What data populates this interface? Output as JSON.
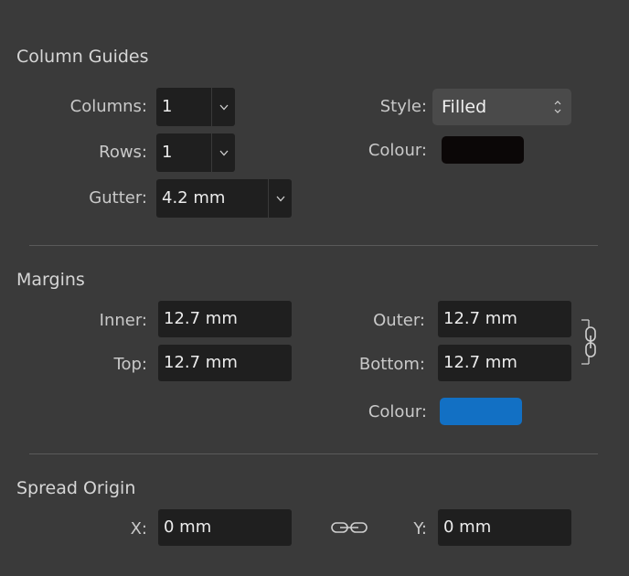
{
  "column_guides": {
    "title": "Column Guides",
    "columns_label": "Columns:",
    "columns_value": "1",
    "rows_label": "Rows:",
    "rows_value": "1",
    "gutter_label": "Gutter:",
    "gutter_value": "4.2 mm",
    "style_label": "Style:",
    "style_value": "Filled",
    "colour_label": "Colour:",
    "colour_value": "#0b0707"
  },
  "margins": {
    "title": "Margins",
    "inner_label": "Inner:",
    "inner_value": "12.7 mm",
    "outer_label": "Outer:",
    "outer_value": "12.7 mm",
    "top_label": "Top:",
    "top_value": "12.7 mm",
    "bottom_label": "Bottom:",
    "bottom_value": "12.7 mm",
    "colour_label": "Colour:",
    "colour_value": "#1270c4",
    "link_icon": "vertical-chain-link-icon"
  },
  "spread_origin": {
    "title": "Spread Origin",
    "x_label": "X:",
    "x_value": "0 mm",
    "y_label": "Y:",
    "y_value": "0 mm",
    "link_icon": "chain-link-icon"
  }
}
